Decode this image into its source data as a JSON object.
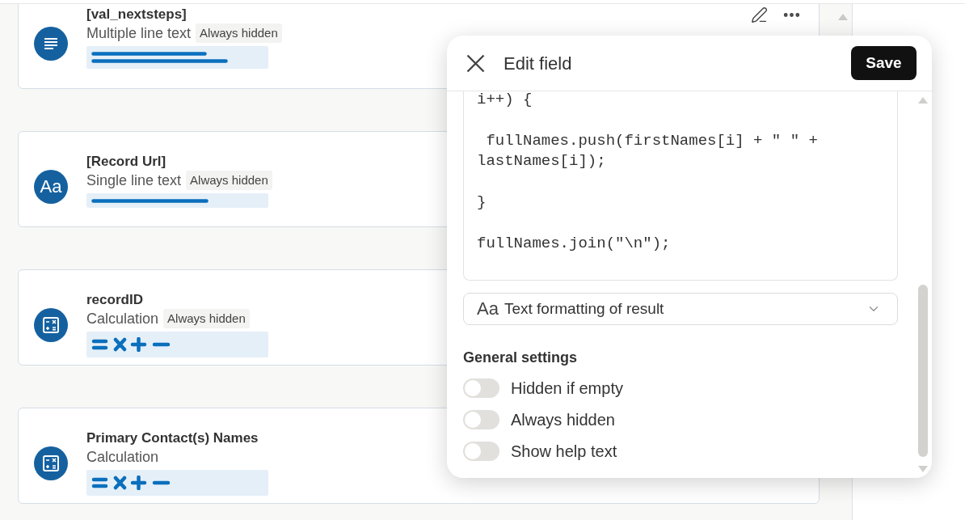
{
  "fields": [
    {
      "title": "[val_nextsteps]",
      "kind": "multiline",
      "type_label": "Multiple line text",
      "badge": "Always hidden",
      "hovered": true
    },
    {
      "title": "[Record Url]",
      "kind": "single_line",
      "icon_text": "Aa",
      "type_label": "Single line text",
      "badge": "Always hidden"
    },
    {
      "title": "recordID",
      "kind": "calculation",
      "type_label": "Calculation",
      "badge": "Always hidden"
    },
    {
      "title": "Primary Contact(s) Names",
      "kind": "calculation",
      "type_label": "Calculation"
    }
  ],
  "edit_panel": {
    "title": "Edit field",
    "save_label": "Save",
    "code": "i++) {\n\n fullNames.push(firstNames[i] + \" \" + lastNames[i]);\n\n}\n\nfullNames.join(\"\\n\");",
    "format_select": {
      "icon_text": "Aa",
      "value": "Text formatting of result"
    },
    "general_settings": {
      "heading": "General settings",
      "toggles": [
        {
          "label": "Hidden if empty",
          "on": false
        },
        {
          "label": "Always hidden",
          "on": false
        },
        {
          "label": "Show help text",
          "on": false
        }
      ]
    }
  }
}
